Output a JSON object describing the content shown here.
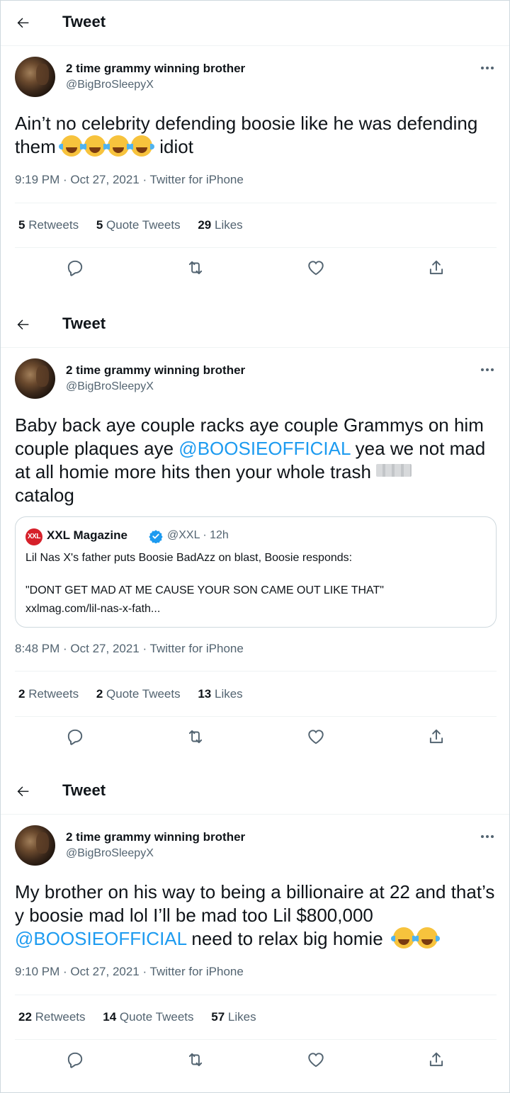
{
  "header_title": "Tweet",
  "user": {
    "name": "2 time grammy winning brother",
    "handle": "@BigBroSleepyX"
  },
  "tweets": [
    {
      "text_before": "Ain’t no celebrity defending boosie like he was defending them",
      "text_after": "idiot",
      "timestamp": "9:19 PM · Oct 27, 2021 · Twitter for iPhone",
      "retweets": "5",
      "retweets_label": "Retweets",
      "quotes": "5",
      "quotes_label": "Quote Tweets",
      "likes": "29",
      "likes_label": "Likes"
    },
    {
      "text_part1": "Baby back aye couple racks aye couple Grammys on him couple plaques aye",
      "mention": "@BOOSIEOFFICIAL",
      "text_part2": "yea we not mad at all homie more hits then your whole trash",
      "text_part3": "catalog",
      "quote": {
        "logo": "XXL",
        "name": "XXL Magazine",
        "handle_time": "@XXL · 12h",
        "line1": "Lil Nas X's father puts Boosie BadAzz on blast, Boosie responds:",
        "line2": "\"DONT GET MAD AT ME CAUSE YOUR SON CAME OUT LIKE THAT\"",
        "link": "xxlmag.com/lil-nas-x-fath..."
      },
      "timestamp": "8:48 PM · Oct 27, 2021 · Twitter for iPhone",
      "retweets": "2",
      "retweets_label": "Retweets",
      "quotes": "2",
      "quotes_label": "Quote Tweets",
      "likes": "13",
      "likes_label": "Likes"
    },
    {
      "text_part1": "My brother on his way to being a billionaire at 22 and that’s y boosie mad lol I’ll be mad too  Lil $800,000",
      "mention": "@BOOSIEOFFICIAL",
      "text_part2": "need to relax big homie",
      "timestamp": "9:10 PM · Oct 27, 2021 · Twitter for iPhone",
      "retweets": "22",
      "retweets_label": "Retweets",
      "quotes": "14",
      "quotes_label": "Quote Tweets",
      "likes": "57",
      "likes_label": "Likes"
    }
  ],
  "icons": {
    "back": "arrow-left-icon",
    "more": "more-horizontal-icon",
    "reply": "reply-icon",
    "retweet": "retweet-icon",
    "like": "heart-icon",
    "share": "share-icon",
    "emoji": "face-with-tears-of-joy-icon",
    "verified": "verified-badge-icon"
  },
  "colors": {
    "accent": "#1d9bf0",
    "text": "#0f1419",
    "secondary": "#536471",
    "border": "#cfd9de"
  }
}
